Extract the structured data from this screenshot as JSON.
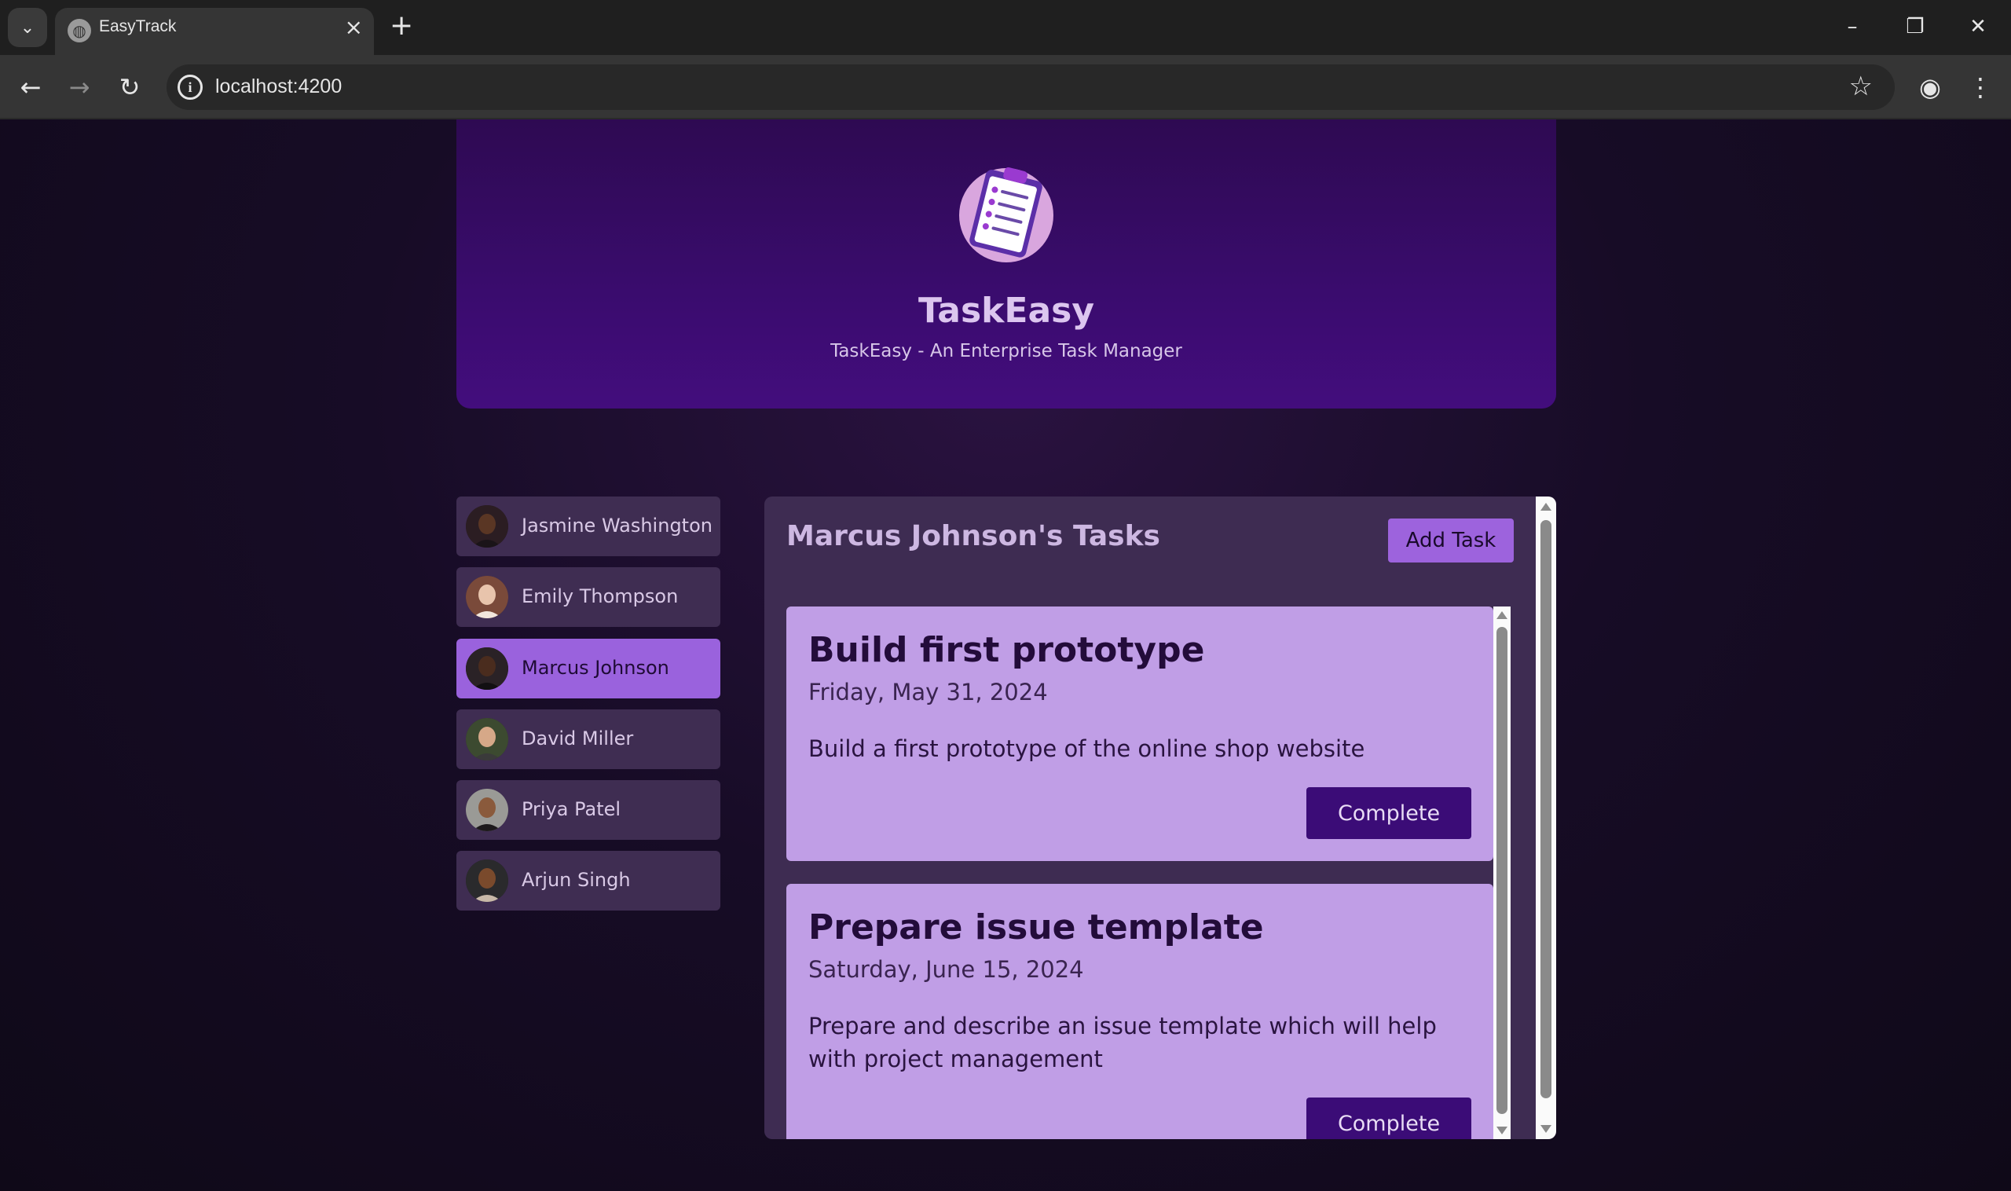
{
  "browser": {
    "tab_title": "EasyTrack",
    "url": "localhost:4200"
  },
  "header": {
    "title": "TaskEasy",
    "subtitle": "TaskEasy - An Enterprise Task Manager"
  },
  "users": [
    {
      "name": "Jasmine Washington",
      "active": false
    },
    {
      "name": "Emily Thompson",
      "active": false
    },
    {
      "name": "Marcus Johnson",
      "active": true
    },
    {
      "name": "David Miller",
      "active": false
    },
    {
      "name": "Priya Patel",
      "active": false
    },
    {
      "name": "Arjun Singh",
      "active": false
    }
  ],
  "tasks_panel": {
    "title": "Marcus Johnson's Tasks",
    "add_label": "Add Task",
    "tasks": [
      {
        "title": "Build first prototype",
        "date": "Friday, May 31, 2024",
        "description": "Build a first prototype of the online shop website",
        "button": "Complete"
      },
      {
        "title": "Prepare issue template",
        "date": "Saturday, June 15, 2024",
        "description": "Prepare and describe an issue template which will help with project management",
        "button": "Complete"
      }
    ]
  },
  "colors": {
    "accent": "#9a62dd",
    "header_bg": "#3a0c6e",
    "task_card": "#c09ee6",
    "complete_button": "#3b0c77"
  },
  "icons": [
    "chevron-down-icon",
    "globe-icon",
    "close-icon",
    "plus-icon",
    "minimize-icon",
    "restore-icon",
    "back-arrow-icon",
    "forward-arrow-icon",
    "reload-icon",
    "info-icon",
    "star-icon",
    "profile-icon",
    "kebab-menu-icon",
    "clipboard-logo-icon"
  ]
}
